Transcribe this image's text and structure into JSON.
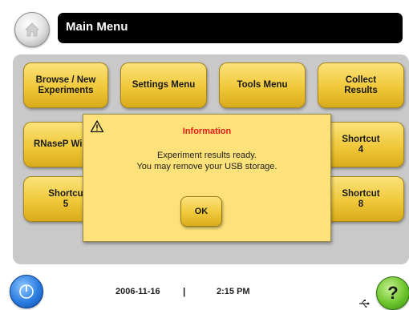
{
  "header": {
    "title": "Main Menu",
    "home_icon": "home-icon"
  },
  "menu": {
    "browse_experiments": "Browse / New\nExperiments",
    "settings_menu": "Settings Menu",
    "tools_menu": "Tools Menu",
    "collect_results": "Collect\nResults",
    "rnasep_wizard": "RNaseP Wi",
    "shortcut_4": "Shortcut\n4",
    "shortcut_5": "Shortcu\n5",
    "shortcut_8": "Shortcut\n8"
  },
  "dialog": {
    "title": "Information",
    "message_line1": "Experiment results ready.",
    "message_line2": "You may remove your USB storage.",
    "ok_label": "OK",
    "icon": "warning-icon"
  },
  "status_bar": {
    "date": "2006-11-16",
    "separator": "|",
    "time": "2:15 PM",
    "power_icon": "power-icon",
    "usb_icon": "usb-icon",
    "help_label": "?"
  },
  "colors": {
    "tile_yellow": "#f0c83a",
    "dialog_yellow": "#fde27a",
    "title_red": "#e61c1c",
    "panel_gray": "#c9c9c9",
    "power_blue": "#2a7de0",
    "help_green": "#6cc42c"
  }
}
